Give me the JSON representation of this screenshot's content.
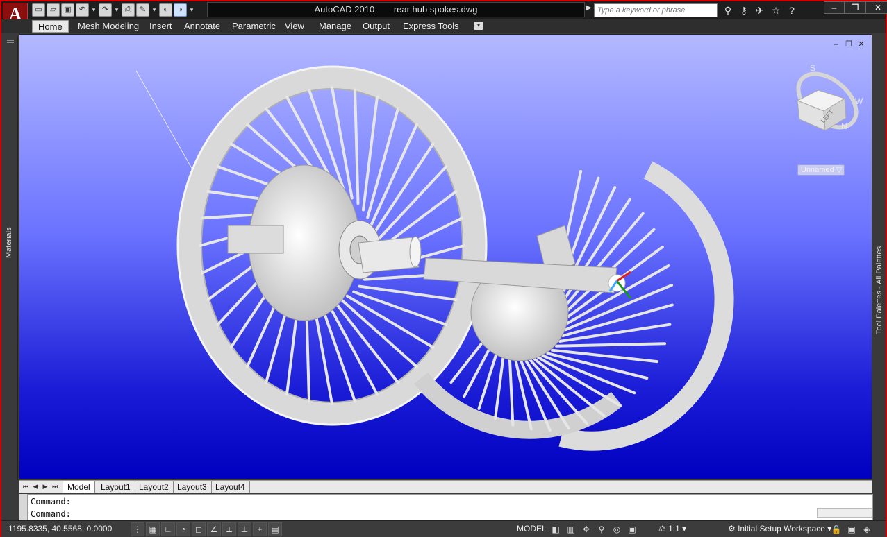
{
  "app": {
    "title": "AutoCAD 2010",
    "file": "rear hub spokes.dwg",
    "logo": "A"
  },
  "search": {
    "placeholder": "Type a keyword or phrase"
  },
  "qat_icons": [
    "new-icon",
    "open-icon",
    "save-icon",
    "undo-icon",
    "redo-icon",
    "plot-icon",
    "publish-icon",
    "render-icon",
    "cloud-icon"
  ],
  "menu": {
    "tabs": [
      "Home",
      "Mesh Modeling",
      "Insert",
      "Annotate",
      "Parametric",
      "View",
      "Manage",
      "Output",
      "Express Tools"
    ],
    "active": "Home"
  },
  "palettes": {
    "left": "Materials",
    "right": "Tool Palettes - All Palettes"
  },
  "viewport": {
    "view_label": "Unnamed",
    "viewcube_face": "LEFT",
    "compass": [
      "S",
      "W",
      "N"
    ],
    "background_top": "#b3b9ff",
    "background_bottom": "#0000c0"
  },
  "layouts": {
    "tabs": [
      "Model",
      "Layout1",
      "Layout2",
      "Layout3",
      "Layout4"
    ],
    "active": "Model"
  },
  "command": {
    "line1": "Command:",
    "line2": "Command:"
  },
  "status": {
    "coords": "1195.8335, 40.5568, 0.0000",
    "model": "MODEL",
    "scale": "1:1",
    "workspace": "Initial Setup Workspace"
  }
}
